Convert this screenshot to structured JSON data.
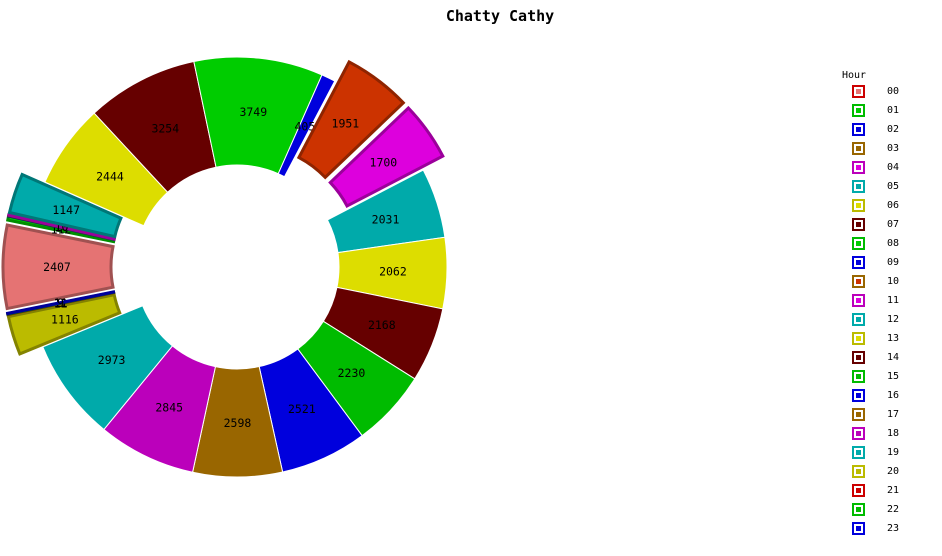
{
  "chart_data": {
    "type": "donut",
    "title": "Chatty Cathy",
    "legend_title": "Hour",
    "legend_position": "right",
    "categories": [
      "00",
      "01",
      "02",
      "03",
      "04",
      "05",
      "06",
      "07",
      "08",
      "09",
      "10",
      "11",
      "12",
      "13",
      "14",
      "15",
      "16",
      "17",
      "18",
      "19",
      "20",
      "21",
      "22",
      "23"
    ],
    "values": [
      2407,
      112,
      14,
      10,
      10,
      1147,
      2444,
      3254,
      3749,
      405,
      1951,
      1700,
      2031,
      2062,
      2168,
      2230,
      2521,
      2598,
      2845,
      2973,
      1116,
      12,
      11,
      9
    ],
    "slice_labels": [
      "2407",
      "112",
      "14",
      "10",
      "10",
      "1147",
      "2444",
      "3254",
      "3749",
      "405",
      "1951",
      "1700",
      "2031",
      "2062",
      "2168",
      "2230",
      "2521",
      "2598",
      "2845",
      "2973",
      "1116",
      "12",
      "11",
      "9"
    ],
    "colors": [
      "#e57373",
      "#00cc00",
      "#0000dd",
      "#996600",
      "#dd00dd",
      "#00aaaa",
      "#dddd00",
      "#660000",
      "#00cc00",
      "#0000dd",
      "#cc3300",
      "#dd00dd",
      "#00aaaa",
      "#dddd00",
      "#660000",
      "#00bb00",
      "#0000dd",
      "#996600",
      "#bb00bb",
      "#00aaaa",
      "#bbbb00",
      "#cc0000",
      "#00bb00",
      "#0000dd"
    ],
    "exploded": [
      true,
      true,
      true,
      true,
      true,
      true,
      false,
      false,
      false,
      false,
      true,
      true,
      false,
      false,
      false,
      false,
      false,
      false,
      false,
      false,
      true,
      true,
      true,
      true
    ],
    "legend_colors": [
      "#cc0000",
      "#00bb00",
      "#0000dd",
      "#996600",
      "#bb00bb",
      "#00aaaa",
      "#bbbb00",
      "#660000",
      "#00bb00",
      "#0000dd",
      "#996600",
      "#bb00bb",
      "#00aaaa",
      "#bbbb00",
      "#660000",
      "#00bb00",
      "#0000dd",
      "#996600",
      "#bb00bb",
      "#00aaaa",
      "#bbbb00",
      "#cc0000",
      "#00bb00",
      "#0000dd"
    ]
  }
}
